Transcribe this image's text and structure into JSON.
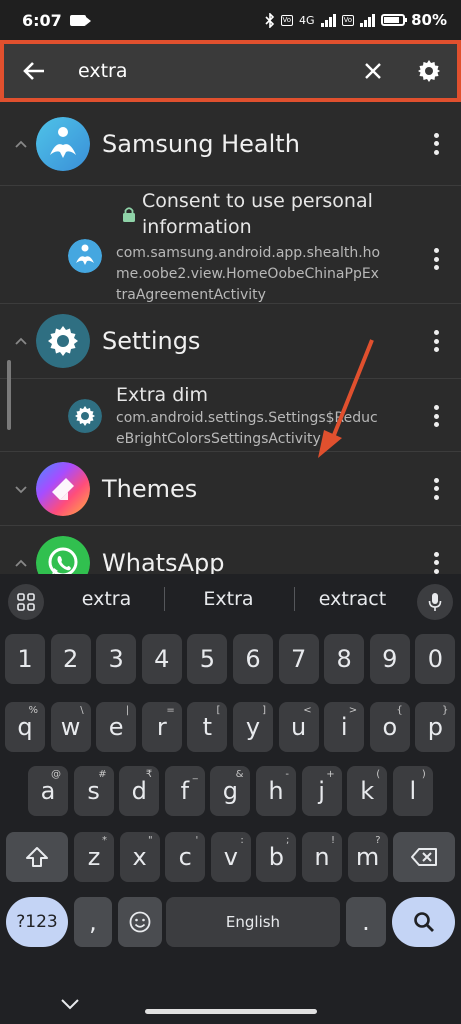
{
  "status": {
    "time": "6:07",
    "battery": "80%",
    "network": "4G"
  },
  "search": {
    "query": "extra"
  },
  "groups": [
    {
      "name": "Samsung Health",
      "expanded": true,
      "activities": [
        {
          "title": "Consent to use personal information",
          "locked": true,
          "package": "com.samsung.android.app.shealth.home.oobe2.view.HomeOobeChinaPpExtraAgreementActivity"
        }
      ]
    },
    {
      "name": "Settings",
      "expanded": true,
      "activities": [
        {
          "title": "Extra dim",
          "locked": false,
          "package": "com.android.settings.Settings$ReduceBrightColorsSettingsActivity"
        }
      ]
    },
    {
      "name": "Themes",
      "expanded": false
    },
    {
      "name": "WhatsApp",
      "expanded": false
    }
  ],
  "keyboard": {
    "suggestions": [
      "extra",
      "Extra",
      "extract"
    ],
    "number_row": [
      "1",
      "2",
      "3",
      "4",
      "5",
      "6",
      "7",
      "8",
      "9",
      "0"
    ],
    "row1": [
      {
        "k": "q",
        "h": "%"
      },
      {
        "k": "w",
        "h": "\\"
      },
      {
        "k": "e",
        "h": "|"
      },
      {
        "k": "r",
        "h": "="
      },
      {
        "k": "t",
        "h": "["
      },
      {
        "k": "y",
        "h": "]"
      },
      {
        "k": "u",
        "h": "<"
      },
      {
        "k": "i",
        "h": ">"
      },
      {
        "k": "o",
        "h": "{"
      },
      {
        "k": "p",
        "h": "}"
      }
    ],
    "row2": [
      {
        "k": "a",
        "h": "@"
      },
      {
        "k": "s",
        "h": "#"
      },
      {
        "k": "d",
        "h": "₹"
      },
      {
        "k": "f",
        "h": "_"
      },
      {
        "k": "g",
        "h": "&"
      },
      {
        "k": "h",
        "h": "-"
      },
      {
        "k": "j",
        "h": "+"
      },
      {
        "k": "k",
        "h": "("
      },
      {
        "k": "l",
        "h": ")"
      }
    ],
    "row3": [
      {
        "k": "z",
        "h": "*"
      },
      {
        "k": "x",
        "h": "\""
      },
      {
        "k": "c",
        "h": "'"
      },
      {
        "k": "v",
        "h": ":"
      },
      {
        "k": "b",
        "h": ";"
      },
      {
        "k": "n",
        "h": "!"
      },
      {
        "k": "m",
        "h": "?"
      }
    ],
    "symbols_label": "?123",
    "comma": ",",
    "space_label": "English",
    "period": "."
  },
  "colors": {
    "highlight": "#e0502e",
    "accent_key": "#c4d4f5"
  }
}
